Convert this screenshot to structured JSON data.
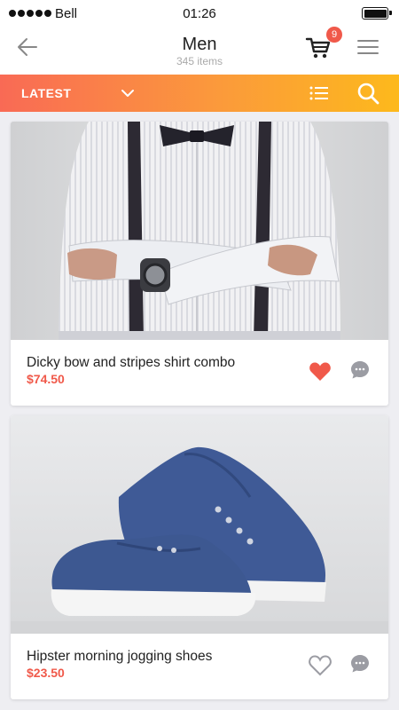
{
  "status_bar": {
    "carrier": "Bell",
    "time": "01:26"
  },
  "header": {
    "title": "Men",
    "subtitle": "345 items",
    "cart_count": "9",
    "icons": {
      "back": "arrow-left-icon",
      "cart": "cart-icon",
      "menu": "hamburger-menu-icon"
    }
  },
  "toolbar": {
    "sort_label": "LATEST",
    "icons": {
      "sort": "chevron-down-icon",
      "view": "list-view-icon",
      "search": "search-icon"
    },
    "gradient": [
      "#f96a55",
      "#fb9a3b",
      "#fdb91c"
    ]
  },
  "products": [
    {
      "name": "Dicky bow and stripes shirt combo",
      "price": "$74.50",
      "liked": true
    },
    {
      "name": "Hipster morning jogging shoes",
      "price": "$23.50",
      "liked": false
    }
  ],
  "colors": {
    "accent": "#f0594a",
    "background": "#eeeef2"
  }
}
